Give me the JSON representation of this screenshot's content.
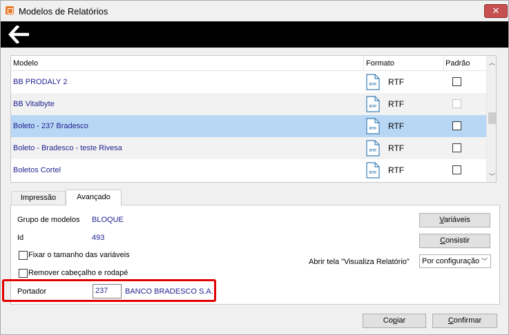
{
  "window": {
    "title": "Modelos de Relatórios",
    "close_glyph": "✕"
  },
  "grid": {
    "headers": {
      "modelo": "Modelo",
      "formato": "Formato",
      "padrao": "Padrão"
    },
    "rows": [
      {
        "name": "BB PRODALY 2",
        "format_icon_text": "RTF",
        "format": "RTF",
        "padrao": false
      },
      {
        "name": "BB Vitalbyte",
        "format_icon_text": "RTF",
        "format": "RTF",
        "padrao": false
      },
      {
        "name": "Boleto - 237 Bradesco",
        "format_icon_text": "RTF",
        "format": "RTF",
        "padrao": false
      },
      {
        "name": "Boleto - Bradesco - teste Rivesa",
        "format_icon_text": "RTF",
        "format": "RTF",
        "padrao": false
      },
      {
        "name": "Boletos Cortel",
        "format_icon_text": "RTF",
        "format": "RTF",
        "padrao": false
      }
    ],
    "selected_index": 2
  },
  "tabs": [
    {
      "label": "Impressão"
    },
    {
      "label": "Avançado"
    }
  ],
  "advanced": {
    "grupo_label": "Grupo de modelos",
    "grupo_value": "BLOQUE",
    "id_label": "Id",
    "id_value": "493",
    "fixar_label": "Fixar o tamanho das variáveis",
    "remover_label": "Remover cabeçalho e rodapé",
    "portador_label": "Portador",
    "portador_code": "237",
    "portador_name": "BANCO BRADESCO S.A.",
    "variaveis_first": "V",
    "variaveis_rest": "ariáveis",
    "consistir_first": "C",
    "consistir_rest": "onsistir",
    "abrir_label": "Abrir tela \"Visualiza Relatório\"",
    "abrir_value": "Por configuração"
  },
  "footer": {
    "copiar_pre": "Co",
    "copiar_u": "p",
    "copiar_post": "iar",
    "confirmar_u": "C",
    "confirmar_post": "onfirmar"
  },
  "colors": {
    "selected_row": "#b8d7f5",
    "highlight": "#e00000",
    "link_text": "#1f1f8f"
  }
}
